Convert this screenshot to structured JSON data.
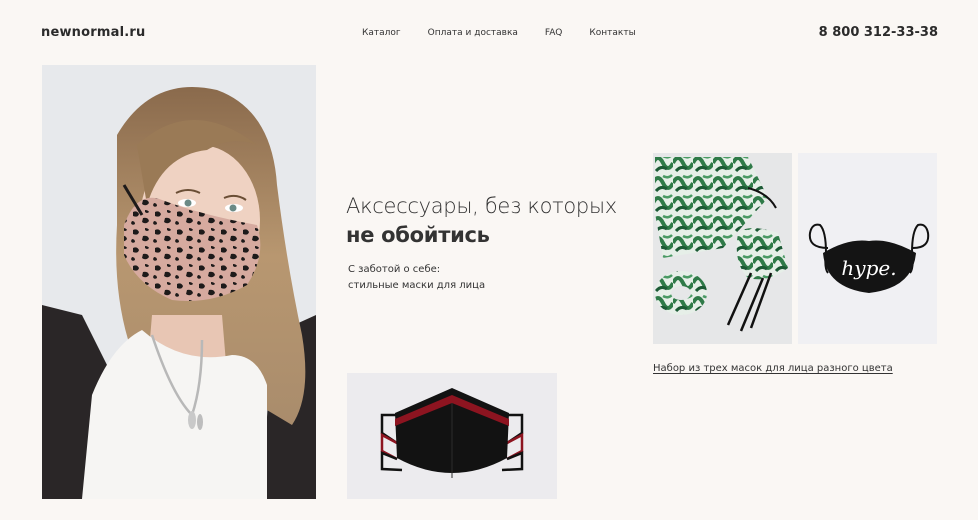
{
  "header": {
    "logo": "newnormal.ru",
    "nav": [
      "Каталог",
      "Оплата и доставка",
      "FAQ",
      "Контакты"
    ],
    "phone": "8 800 312-33-38"
  },
  "hero": {
    "headline_line1": "Аксессуары, без которых",
    "headline_line2": "не обойтись",
    "sub_line1": "С заботой о себе:",
    "sub_line2": "стильные маски для лица"
  },
  "products": {
    "set_link": "Набор из трех масок для лица разного цвета",
    "hype_text": "hype."
  },
  "colors": {
    "background": "#faf7f4",
    "text": "#2b2b2b",
    "mask_red": "#8d1420"
  }
}
